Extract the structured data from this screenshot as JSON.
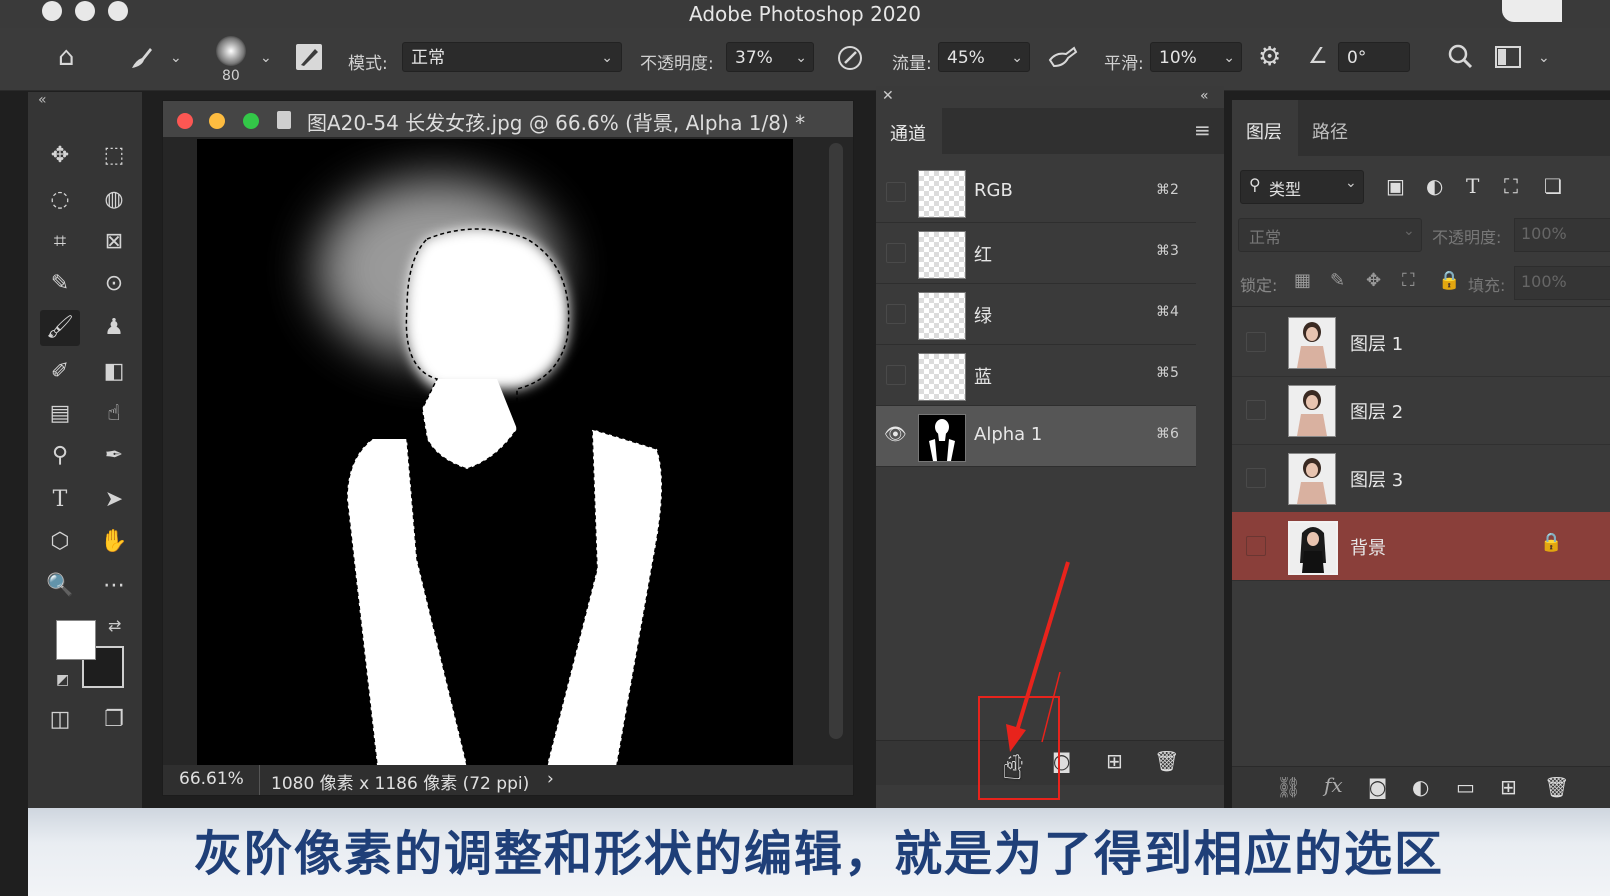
{
  "app": {
    "title": "Adobe Photoshop 2020"
  },
  "options_bar": {
    "brush_size": "80",
    "mode_label": "模式:",
    "mode_value": "正常",
    "opacity_label": "不透明度:",
    "opacity_value": "37%",
    "flow_label": "流量:",
    "flow_value": "45%",
    "smoothing_label": "平滑:",
    "smoothing_value": "10%",
    "angle_value": "0°"
  },
  "document": {
    "title": "图A20-54 长发女孩.jpg @ 66.6% (背景, Alpha 1/8) *",
    "zoom": "66.61%",
    "info": "1080 像素 x 1186 像素 (72 ppi)",
    "info_arrow": "›"
  },
  "channels_panel": {
    "tab": "通道",
    "channels": [
      {
        "name": "RGB",
        "shortcut": "⌘2",
        "visible": false
      },
      {
        "name": "红",
        "shortcut": "⌘3",
        "visible": false
      },
      {
        "name": "绿",
        "shortcut": "⌘4",
        "visible": false
      },
      {
        "name": "蓝",
        "shortcut": "⌘5",
        "visible": false
      },
      {
        "name": "Alpha 1",
        "shortcut": "⌘6",
        "visible": true
      }
    ]
  },
  "layers_panel": {
    "tabs": [
      "图层",
      "路径"
    ],
    "filter_label": "类型",
    "blend_mode": "正常",
    "opacity_label": "不透明度:",
    "opacity_value": "100%",
    "lock_label": "锁定:",
    "fill_label": "填充:",
    "fill_value": "100%",
    "layers": [
      {
        "name": "图层 1"
      },
      {
        "name": "图层 2"
      },
      {
        "name": "图层 3"
      },
      {
        "name": "背景",
        "locked": true
      }
    ]
  },
  "subtitle": "灰阶像素的调整和形状的编辑，就是为了得到相应的选区",
  "colors": {
    "selected_layer": "#8a3f3a",
    "annotation_red": "#e8231c",
    "subtitle_text": "#1f3f78"
  }
}
